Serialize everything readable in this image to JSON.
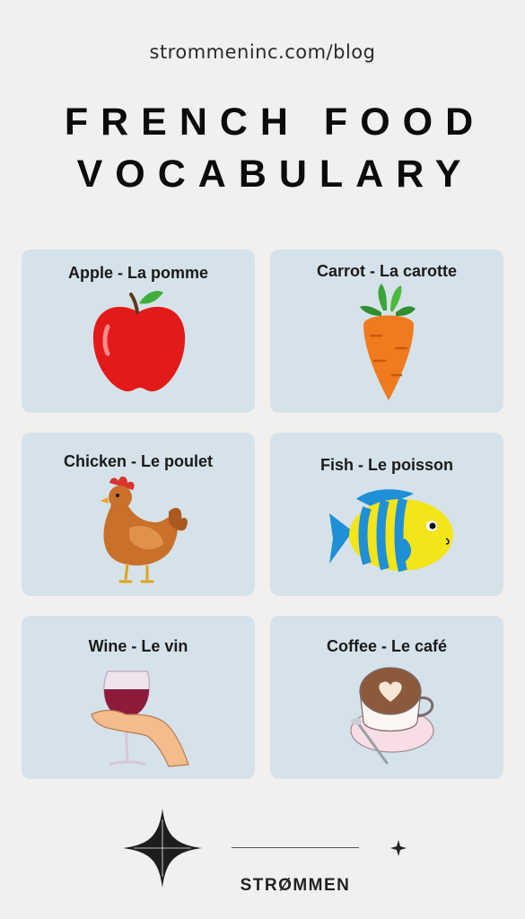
{
  "header": {
    "url": "strommeninc.com/blog",
    "title_line1": "FRENCH FOOD",
    "title_line2": "VOCABULARY"
  },
  "cards": [
    {
      "label": "Apple - La pomme",
      "icon": "apple-icon"
    },
    {
      "label": "Carrot - La carotte",
      "icon": "carrot-icon"
    },
    {
      "label": "Chicken - Le poulet",
      "icon": "chicken-icon"
    },
    {
      "label": "Fish - Le poisson",
      "icon": "fish-icon"
    },
    {
      "label": "Wine - Le vin",
      "icon": "wine-glass-icon"
    },
    {
      "label": "Coffee - Le café",
      "icon": "coffee-cup-icon"
    }
  ],
  "footer": {
    "brand": "STRØMMEN"
  },
  "colors": {
    "background": "#f2f0ee",
    "card": "#d6e2ea",
    "text": "#111111"
  }
}
